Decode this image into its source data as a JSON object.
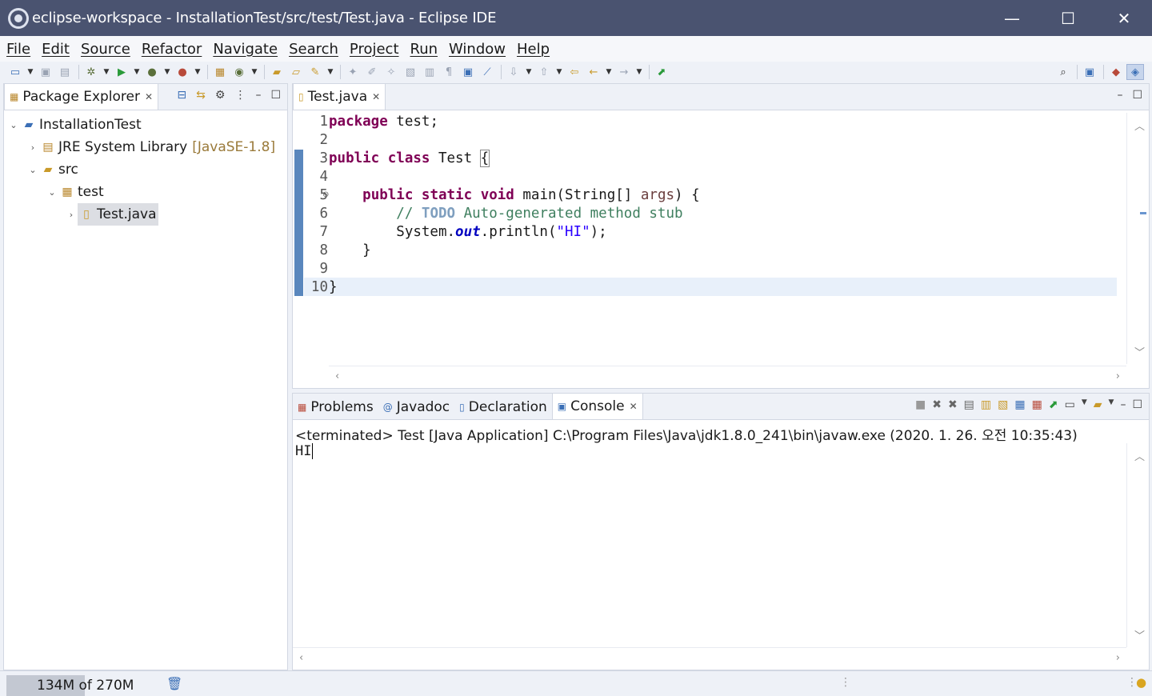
{
  "window": {
    "title": "eclipse-workspace - InstallationTest/src/test/Test.java - Eclipse IDE",
    "minimize": "—",
    "maximize": "☐",
    "close": "✕"
  },
  "menu": [
    "File",
    "Edit",
    "Source",
    "Refactor",
    "Navigate",
    "Search",
    "Project",
    "Run",
    "Window",
    "Help"
  ],
  "package_explorer": {
    "tab_label": "Package Explorer",
    "tree": [
      {
        "label": "InstallationTest",
        "suffix": ""
      },
      {
        "label": "JRE System Library",
        "suffix": "[JavaSE-1.8]"
      },
      {
        "label": "src",
        "suffix": ""
      },
      {
        "label": "test",
        "suffix": ""
      },
      {
        "label": "Test.java",
        "suffix": ""
      }
    ]
  },
  "editor": {
    "tab_label": "Test.java",
    "line_numbers": [
      "1",
      "2",
      "3",
      "4",
      "5",
      "6",
      "7",
      "8",
      "9",
      "10"
    ]
  },
  "bottom_tabs": {
    "problems": "Problems",
    "javadoc": "Javadoc",
    "declaration": "Declaration",
    "console": "Console"
  },
  "console": {
    "header": "<terminated> Test [Java Application] C:\\Program Files\\Java\\jdk1.8.0_241\\bin\\javaw.exe (2020. 1. 26. 오전 10:35:43)",
    "output": "HI"
  },
  "status": {
    "heap": "134M of 270M",
    "heap_fraction": 0.5
  },
  "colors": {
    "titlebar": "#4a5370",
    "keyword": "#7f0055",
    "comment": "#3f7f5f",
    "string": "#2a00ff",
    "field": "#0000c0"
  }
}
